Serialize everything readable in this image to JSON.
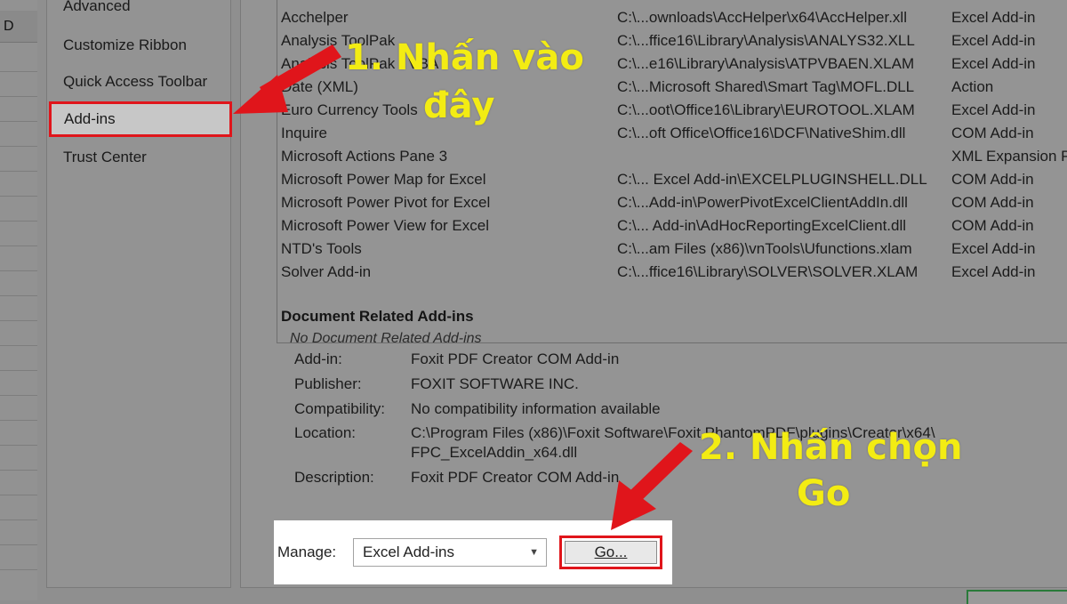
{
  "sheet": {
    "column_letter": "D"
  },
  "nav": {
    "items": [
      {
        "label": "Advanced",
        "selected": false
      },
      {
        "label": "Customize Ribbon",
        "selected": false
      },
      {
        "label": "Quick Access Toolbar",
        "selected": false
      },
      {
        "label": "Add-ins",
        "selected": true
      },
      {
        "label": "Trust Center",
        "selected": false
      }
    ]
  },
  "addins": {
    "rows": [
      {
        "name": "Acchelper",
        "location": "C:\\...ownloads\\AccHelper\\x64\\AccHelper.xll",
        "type": "Excel Add-in"
      },
      {
        "name": "Analysis ToolPak",
        "location": "C:\\...ffice16\\Library\\Analysis\\ANALYS32.XLL",
        "type": "Excel Add-in"
      },
      {
        "name": "Analysis ToolPak - VBA",
        "location": "C:\\...e16\\Library\\Analysis\\ATPVBAEN.XLAM",
        "type": "Excel Add-in"
      },
      {
        "name": "Date (XML)",
        "location": "C:\\...Microsoft Shared\\Smart Tag\\MOFL.DLL",
        "type": "Action"
      },
      {
        "name": "Euro Currency Tools",
        "location": "C:\\...oot\\Office16\\Library\\EUROTOOL.XLAM",
        "type": "Excel Add-in"
      },
      {
        "name": "Inquire",
        "location": "C:\\...oft Office\\Office16\\DCF\\NativeShim.dll",
        "type": "COM Add-in"
      },
      {
        "name": "Microsoft Actions Pane 3",
        "location": "",
        "type": "XML Expansion Pack"
      },
      {
        "name": "Microsoft Power Map for Excel",
        "location": "C:\\... Excel Add-in\\EXCELPLUGINSHELL.DLL",
        "type": "COM Add-in"
      },
      {
        "name": "Microsoft Power Pivot for Excel",
        "location": "C:\\...Add-in\\PowerPivotExcelClientAddIn.dll",
        "type": "COM Add-in"
      },
      {
        "name": "Microsoft Power View for Excel",
        "location": "C:\\... Add-in\\AdHocReportingExcelClient.dll",
        "type": "COM Add-in"
      },
      {
        "name": "NTD's Tools",
        "location": "C:\\...am Files (x86)\\vnTools\\Ufunctions.xlam",
        "type": "Excel Add-in"
      },
      {
        "name": "Solver Add-in",
        "location": "C:\\...ffice16\\Library\\SOLVER\\SOLVER.XLAM",
        "type": "Excel Add-in"
      }
    ],
    "document_section_title": "Document Related Add-ins",
    "no_document_text": "No Document Related Add-ins"
  },
  "details": {
    "addin_label": "Add-in:",
    "addin_value": "Foxit PDF Creator COM Add-in",
    "publisher_label": "Publisher:",
    "publisher_value": "FOXIT SOFTWARE INC.",
    "compat_label": "Compatibility:",
    "compat_value": "No compatibility information available",
    "location_label": "Location:",
    "location_value_1": "C:\\Program Files (x86)\\Foxit Software\\Foxit PhantomPDF\\plugins\\Creator\\x64\\",
    "location_value_2": "FPC_ExcelAddin_x64.dll",
    "description_label": "Description:",
    "description_value": "Foxit PDF Creator COM Add-in"
  },
  "manage": {
    "label": "Manage:",
    "selected": "Excel Add-ins",
    "go_label": "Go..."
  },
  "annotations": {
    "step1_line1": "1. Nhấn vào",
    "step1_line2": "đây",
    "step2_line1": "2. Nhấn chọn",
    "step2_line2": "Go",
    "color": "#f3ec13",
    "arrow_color": "#e0151b"
  }
}
